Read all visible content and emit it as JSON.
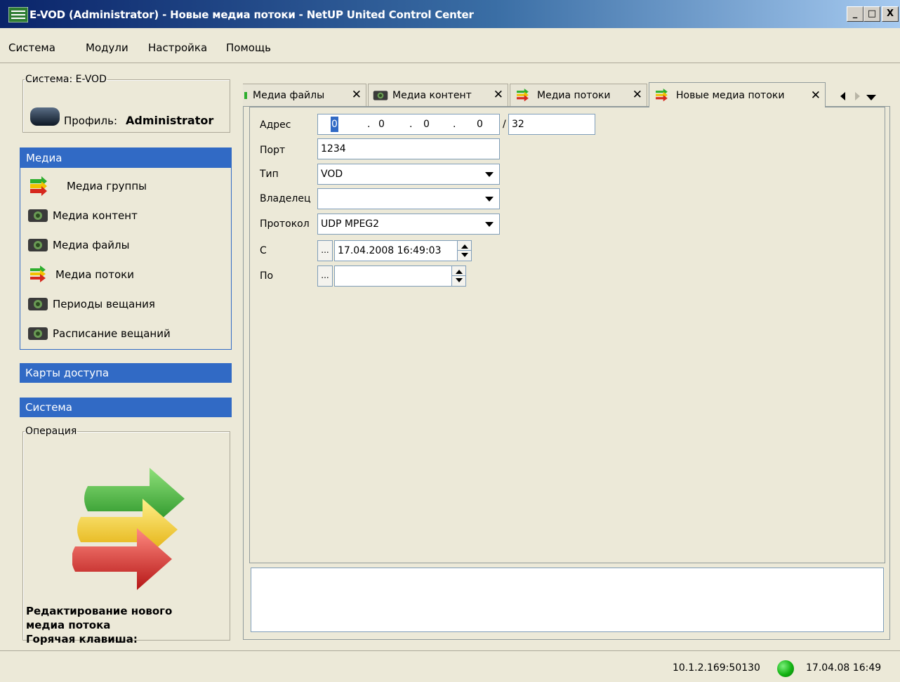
{
  "window": {
    "title": "E-VOD (Administrator) - Новые медиа потоки - NetUP United Control Center",
    "minimize": "_",
    "maximize": "□",
    "close": "X"
  },
  "menu": [
    "Система",
    "Модули",
    "Настройка",
    "Помощь"
  ],
  "system_box": {
    "legend": "Система: E-VOD",
    "profile_label": "Профиль:",
    "profile_value": "Administrator"
  },
  "media_panel": {
    "header": "Медиа",
    "items": [
      {
        "label": "Медиа группы",
        "icon": "arrows-icon"
      },
      {
        "label": "Медиа контент",
        "icon": "camera-icon"
      },
      {
        "label": "Медиа файлы",
        "icon": "camera-icon"
      },
      {
        "label": "Медиа потоки",
        "icon": "arrows-icon"
      },
      {
        "label": "Периоды вещания",
        "icon": "camera-icon"
      },
      {
        "label": "Расписание вещаний",
        "icon": "camera-icon"
      }
    ]
  },
  "access_cards_header": "Карты доступа",
  "system_header": "Система",
  "operation": {
    "legend": "Операция",
    "description_line1": "Редактирование нового",
    "description_line2": "медиа потока",
    "hotkey_label": "Горячая клавиша:"
  },
  "tabs": [
    {
      "label": "Медиа файлы",
      "icon": "camera-icon",
      "active": false
    },
    {
      "label": "Медиа контент",
      "icon": "camera-icon",
      "active": false
    },
    {
      "label": "Медиа потоки",
      "icon": "arrows-icon",
      "active": false
    },
    {
      "label": "Новые медиа потоки",
      "icon": "arrows-icon",
      "active": true
    }
  ],
  "tab_close_glyph": "✕",
  "form": {
    "address_label": "Адрес",
    "address_octets": [
      "0",
      "0",
      "0",
      "0"
    ],
    "address_mask": "32",
    "port_label": "Порт",
    "port_value": "1234",
    "type_label": "Тип",
    "type_value": "VOD",
    "owner_label": "Владелец",
    "owner_value": "",
    "protocol_label": "Протокол",
    "protocol_value": "UDP MPEG2",
    "from_label": "С",
    "from_value": "17.04.2008 16:49:03",
    "to_label": "По",
    "to_value": "",
    "dots": "..."
  },
  "status": {
    "connection": "10.1.2.169:50130",
    "led_color": "#13b313",
    "time": "17.04.08 16:49"
  }
}
